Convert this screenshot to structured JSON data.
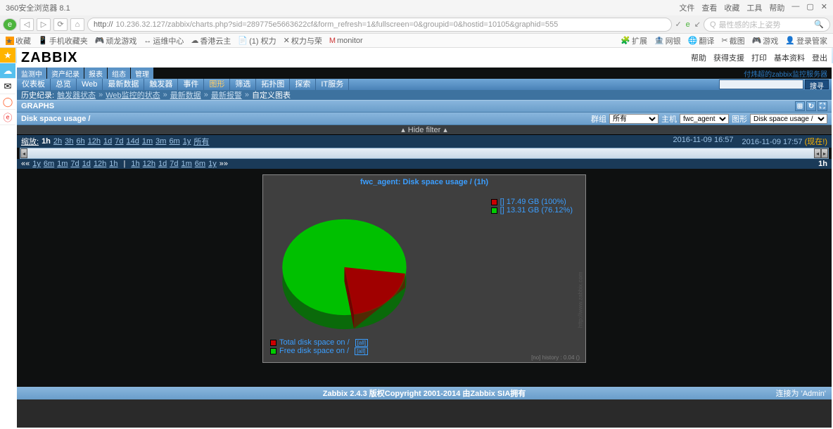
{
  "browser": {
    "title_left": "360安全浏览器 8.1",
    "title_right": [
      "文件",
      "查看",
      "收藏",
      "工具",
      "帮助"
    ],
    "nav_icons": {
      "back": "◁",
      "forward": "▷",
      "reload": "⟳",
      "home": "⌂"
    },
    "url_label": "http://",
    "url": "10.236.32.127/zabbix/charts.php?sid=289775e5663622cf&form_refresh=1&fullscreen=0&groupid=0&hostid=10105&graphid=555",
    "addr_right": [
      "✓",
      "e",
      "↙"
    ],
    "search_placeholder": "最性感的床上姿势",
    "bookmarks_left": [
      "收藏",
      "手机收藏夹",
      "顽龙游戏",
      "运维中心",
      "香港云主",
      "(1) 权力",
      "权力与荣",
      "monitor"
    ],
    "bookmarks_right": [
      "扩展",
      "网银",
      "翻译",
      "截图",
      "游戏",
      "登录管家"
    ],
    "tab_title": "付炜超的zabbix监控服务器: [",
    "left_icons": [
      "★",
      "☁",
      "✉",
      "◯",
      "ⓔ"
    ]
  },
  "zabbix": {
    "logo": "ZABBIX",
    "header_links": [
      "帮助",
      "获得支援",
      "打印",
      "基本资料",
      "登出"
    ],
    "nav1": [
      {
        "label": "监测中",
        "active": true
      },
      {
        "label": "资产纪录"
      },
      {
        "label": "报表"
      },
      {
        "label": "组态"
      },
      {
        "label": "管理"
      }
    ],
    "hostname": "付炜超的zabbix监控服务器",
    "nav2": [
      "仪表板",
      "总览",
      "Web",
      "最新数据",
      "触发器",
      "事件",
      "图形",
      "筛选",
      "拓扑图",
      "探索",
      "IT服务"
    ],
    "search_button": "搜寻",
    "breadcrumb_label": "历史纪录:",
    "breadcrumb": [
      "触发器状态",
      "Web监控的状态",
      "最新数据",
      "最新报警",
      "自定义图表"
    ],
    "section_title": "GRAPHS",
    "page_title": "Disk space usage /",
    "group_label": "群组",
    "group_value": "所有",
    "host_label": "主机",
    "host_value": "fwc_agent",
    "graph_label": "图形",
    "graph_value": "Disk space usage /",
    "filter_toggle": "Hide filter",
    "zoom_label": "缩放:",
    "zoom_current": "1h",
    "zoom_options": [
      "2h",
      "3h",
      "6h",
      "12h",
      "1d",
      "7d",
      "14d",
      "1m",
      "3m",
      "6m",
      "1y",
      "所有"
    ],
    "time_from": "2016-11-09 16:57",
    "time_to": "2016-11-09 17:57",
    "now_tag": "(现在!)",
    "back_options": [
      "1y",
      "6m",
      "1m",
      "7d",
      "1d",
      "12h",
      "1h"
    ],
    "fwd_options": [
      "1h",
      "12h",
      "1d",
      "7d",
      "1m",
      "6m",
      "1y"
    ],
    "duration": "1h"
  },
  "chart_data": {
    "type": "pie",
    "title": "fwc_agent: Disk space usage / (1h)",
    "series": [
      {
        "name": "Total disk space on /",
        "value": 17.49,
        "unit": "GB",
        "percent": 100,
        "color": "#c00000"
      },
      {
        "name": "Free disk space on /",
        "value": 13.31,
        "unit": "GB",
        "percent": 76.12,
        "color": "#00c000"
      }
    ],
    "legend_top": [
      "[] 17.49 GB (100%)",
      "[] 13.31 GB (76.12%)"
    ],
    "legend_bottom": [
      "Total disk space on /",
      "Free disk space on /"
    ],
    "tag": "[all]",
    "footer": "[no] history : 0.04 ()",
    "watermark": "http://www.zabbix.com"
  },
  "footer": {
    "copyright": "Zabbix 2.4.3 版权Copyright 2001-2014 由Zabbix SIA拥有",
    "connected": "连接为 'Admin'"
  }
}
